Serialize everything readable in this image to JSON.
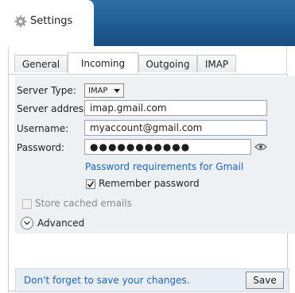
{
  "header": {
    "title": "Settings",
    "icon": "gear-icon"
  },
  "tabs": [
    {
      "label": "General",
      "active": false
    },
    {
      "label": "Incoming",
      "active": true
    },
    {
      "label": "Outgoing",
      "active": false
    },
    {
      "label": "IMAP",
      "active": false
    }
  ],
  "form": {
    "server_type_label": "Server Type:",
    "server_type_value": "IMAP",
    "server_address_label": "Server address:",
    "server_address_value": "imap.gmail.com",
    "username_label": "Username:",
    "username_value": "myaccount@gmail.com",
    "password_label": "Password:",
    "password_masked": "●●●●●●●●●●●",
    "password_link": "Password requirements for Gmail",
    "remember_password_label": "Remember password",
    "remember_password_checked": true,
    "store_cached_label": "Store cached emails",
    "store_cached_checked": false,
    "advanced_label": "Advanced"
  },
  "footer": {
    "message": "Don't forget to save your changes.",
    "save_label": "Save"
  },
  "colors": {
    "top_bar": "#1f5b91",
    "link": "#1f64b0",
    "form_background": "#eef1f4"
  }
}
